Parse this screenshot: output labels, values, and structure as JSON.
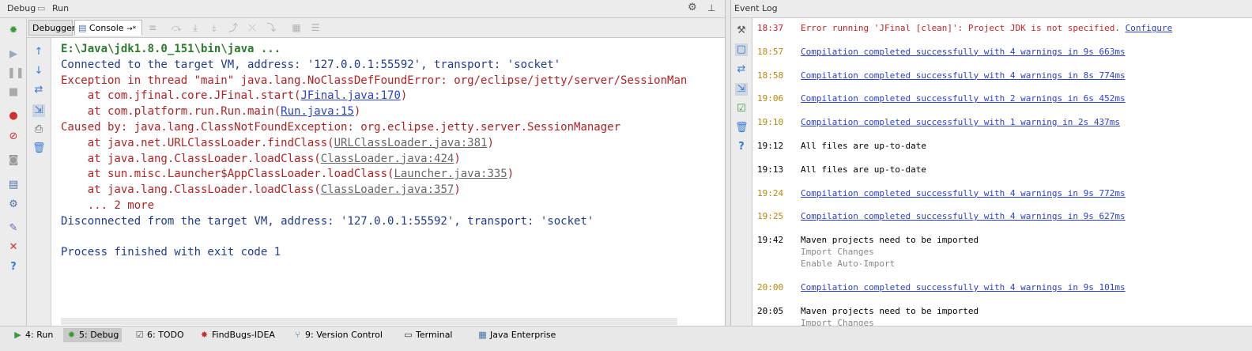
{
  "header": {
    "debug_tab": "Debug",
    "run_tab": "Run",
    "event_log_title": "Event Log"
  },
  "tabs": {
    "debugger": "Debugger",
    "console": "Console",
    "console_suffix": "→*"
  },
  "console": {
    "lines": [
      {
        "text": "E:\\Java\\jdk1.8.0_151\\bin\\java ...",
        "color": "#2b7b2b"
      },
      {
        "text": "Connected to the target VM, address: '127.0.0.1:55592', transport: 'socket'",
        "color": "#1f3a93"
      },
      {
        "text": "Exception in thread \"main\" java.lang.NoClassDefFoundError: org/eclipse/jetty/server/SessionMan",
        "color": "#b22222"
      },
      {
        "text": "    at com.jfinal.core.JFinal.start(",
        "link": "JFinal.java:170",
        "after": ")",
        "color": "#b22222"
      },
      {
        "text": "    at com.platform.run.Run.main(",
        "link": "Run.java:15",
        "after": ")",
        "color": "#b22222"
      },
      {
        "text": "Caused by: java.lang.ClassNotFoundException: org.eclipse.jetty.server.SessionManager",
        "color": "#b22222"
      },
      {
        "text": "    at java.net.URLClassLoader.findClass(",
        "glink": "URLClassLoader.java:381",
        "after": ")",
        "color": "#b22222"
      },
      {
        "text": "    at java.lang.ClassLoader.loadClass(",
        "glink": "ClassLoader.java:424",
        "after": ")",
        "color": "#b22222"
      },
      {
        "text": "    at sun.misc.Launcher$AppClassLoader.loadClass(",
        "glink": "Launcher.java:335",
        "after": ")",
        "color": "#b22222"
      },
      {
        "text": "    at java.lang.ClassLoader.loadClass(",
        "glink": "ClassLoader.java:357",
        "after": ")",
        "color": "#b22222"
      },
      {
        "text": "    ... 2 more",
        "color": "#b22222"
      },
      {
        "text": "Disconnected from the target VM, address: '127.0.0.1:55592', transport: 'socket'",
        "color": "#1f3a93"
      },
      {
        "text": "",
        "color": "#000"
      },
      {
        "text": "Process finished with exit code 1",
        "color": "#1f3a93"
      }
    ]
  },
  "event_log": {
    "entries": [
      {
        "time": "18:37",
        "message": "Error running 'JFinal [clean]': Project JDK is not specified.",
        "action": "Configure",
        "type": "error"
      },
      {
        "time": "18:57",
        "message": "Compilation completed successfully with 4 warnings in 9s 663ms",
        "type": "warn"
      },
      {
        "time": "18:58",
        "message": "Compilation completed successfully with 4 warnings in 8s 774ms",
        "type": "warn"
      },
      {
        "time": "19:06",
        "message": "Compilation completed successfully with 2 warnings in 6s 452ms",
        "type": "warn"
      },
      {
        "time": "19:10",
        "message": "Compilation completed successfully with 1 warning in 2s 437ms",
        "type": "warn"
      },
      {
        "time": "19:12",
        "message": "All files are up-to-date",
        "type": "info"
      },
      {
        "time": "19:13",
        "message": "All files are up-to-date",
        "type": "info"
      },
      {
        "time": "19:24",
        "message": "Compilation completed successfully with 4 warnings in 9s 772ms",
        "type": "warn"
      },
      {
        "time": "19:25",
        "message": "Compilation completed successfully with 4 warnings in 9s 627ms",
        "type": "warn"
      },
      {
        "time": "19:42",
        "message": "Maven projects need to be imported",
        "sub": [
          "Import Changes",
          "Enable Auto-Import"
        ],
        "type": "info"
      },
      {
        "time": "20:00",
        "message": "Compilation completed successfully with 4 warnings in 9s 101ms",
        "type": "warn"
      },
      {
        "time": "20:05",
        "message": "Maven projects need to be imported",
        "sub": [
          "Import Changes"
        ],
        "type": "info"
      }
    ]
  },
  "bottom_tabs": [
    {
      "label": "4: Run",
      "icon": "run-icon",
      "selected": false
    },
    {
      "label": "5: Debug",
      "icon": "debug-icon",
      "selected": true
    },
    {
      "label": "6: TODO",
      "icon": "todo-icon",
      "selected": false
    },
    {
      "label": "FindBugs-IDEA",
      "icon": "bug-icon",
      "selected": false
    },
    {
      "label": "9: Version Control",
      "icon": "vcs-icon",
      "selected": false
    },
    {
      "label": "Terminal",
      "icon": "terminal-icon",
      "selected": false
    },
    {
      "label": "Java Enterprise",
      "icon": "java-enterprise-icon",
      "selected": false
    }
  ],
  "colors": {
    "time_warn": "#b8860b",
    "time_error": "#d02020",
    "error_text": "#d02020",
    "link": "#2a3fd4"
  }
}
